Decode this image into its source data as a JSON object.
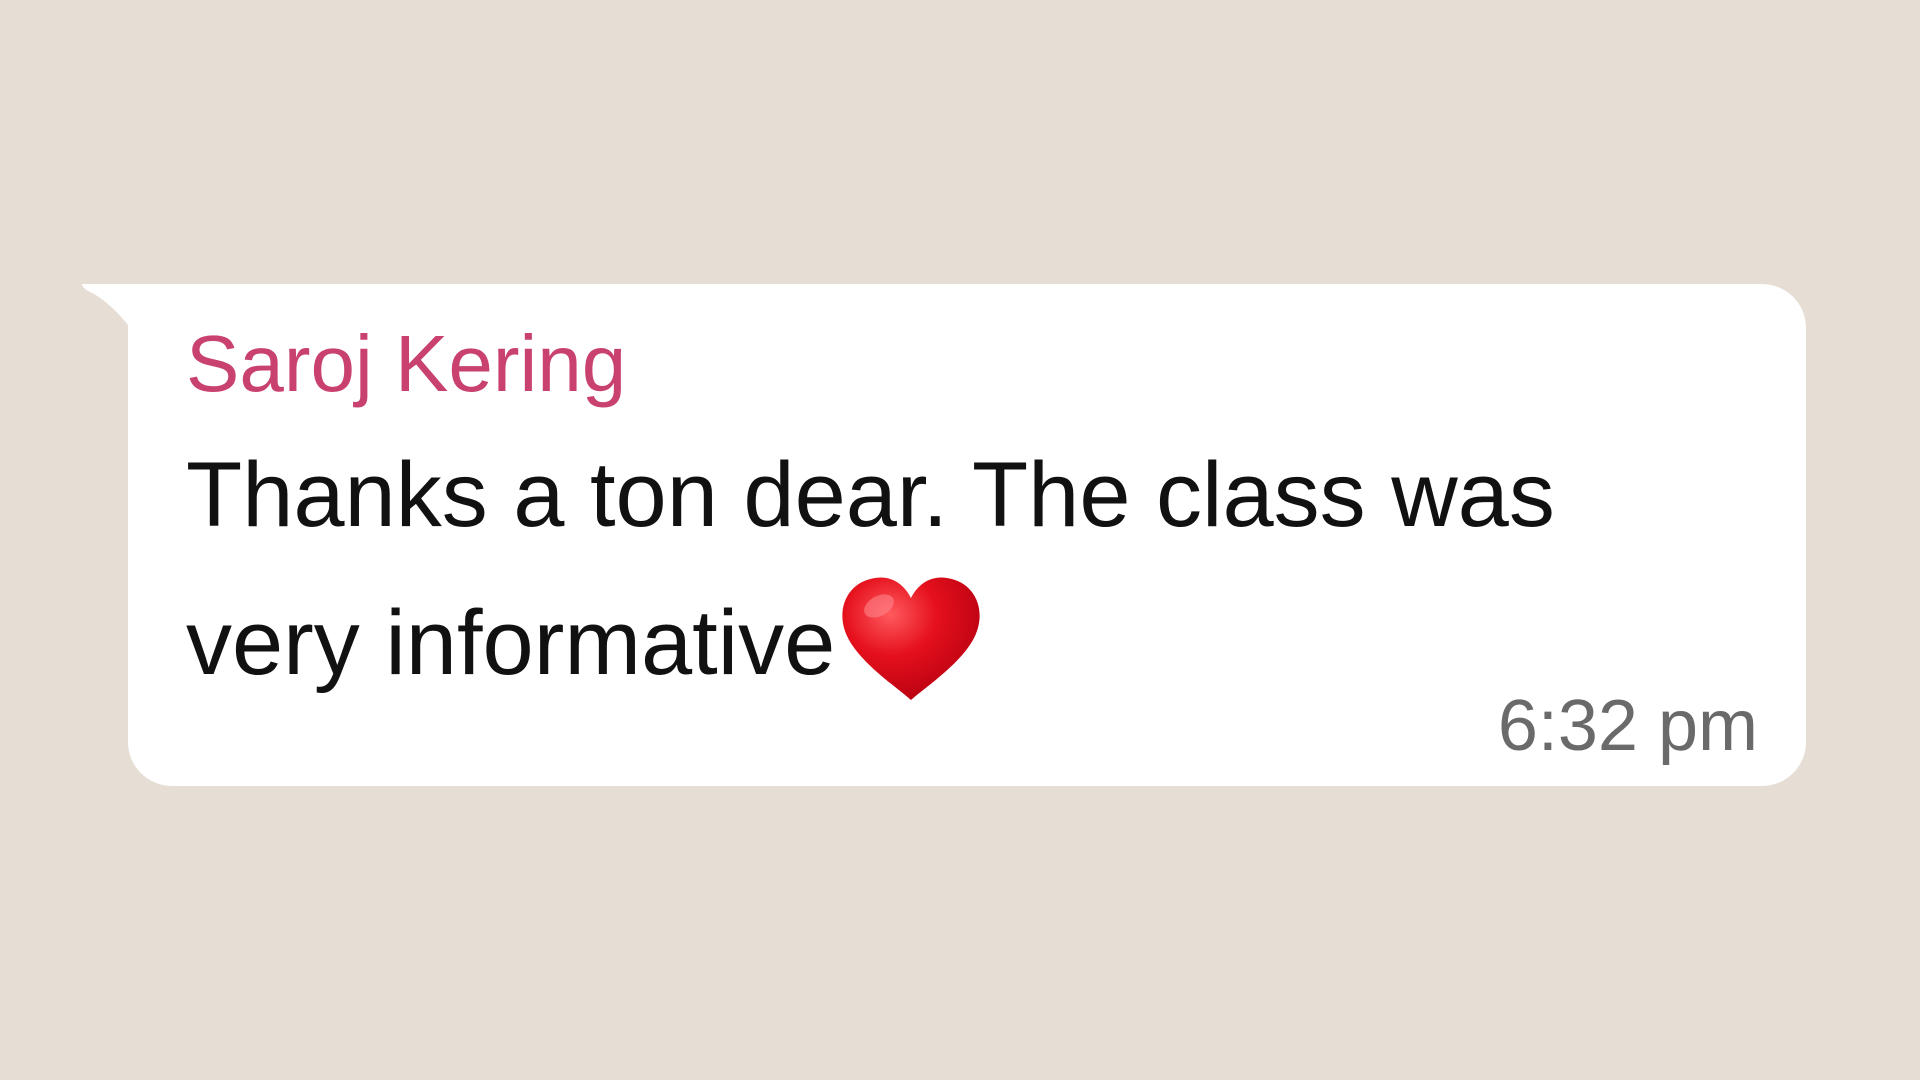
{
  "message": {
    "sender_name": "Saroj Kering",
    "text": "Thanks a ton dear. The class was very informative",
    "emoji": "heart-icon",
    "timestamp": "6:32 pm"
  },
  "colors": {
    "background": "#e6ddd4",
    "bubble": "#ffffff",
    "sender_name": "#c9426f",
    "message_text": "#111111",
    "timestamp": "#6a6a6a",
    "heart": "#e5101c"
  }
}
